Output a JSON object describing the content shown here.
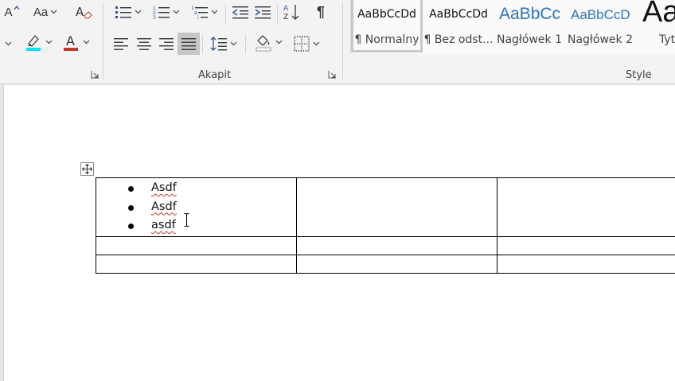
{
  "ribbon": {
    "font_group": {
      "shrink_font_glyph": "A",
      "change_case_glyph": "Aa",
      "font_color_glyph": "A",
      "highlight_color": "#00e5ff",
      "font_color": "#c0392b"
    },
    "paragraph_group": {
      "label": "Akapit",
      "show_marks_glyph": "¶"
    },
    "styles_group": {
      "label": "Style",
      "items": [
        {
          "sample": "AaBbCcDd",
          "name": "¶ Normalny",
          "selected": true
        },
        {
          "sample": "AaBbCcDd",
          "name": "¶ Bez odst...",
          "selected": false
        },
        {
          "sample": "AaBbCc",
          "name": "Nagłówek 1",
          "selected": false
        },
        {
          "sample": "AaBbCcD",
          "name": "Nagłówek 2",
          "selected": false
        },
        {
          "sample": "Aa",
          "name": "Tyt",
          "selected": false
        }
      ]
    }
  },
  "document": {
    "table": {
      "rows": [
        {
          "cells": [
            {
              "bullets": [
                "Asdf",
                "Asdf",
                "asdf"
              ]
            },
            {
              "text": ""
            },
            {
              "text": ""
            }
          ]
        },
        {
          "cells": [
            {
              "text": ""
            },
            {
              "text": ""
            },
            {
              "text": ""
            }
          ]
        },
        {
          "cells": [
            {
              "text": ""
            },
            {
              "text": ""
            },
            {
              "text": ""
            }
          ]
        }
      ]
    }
  },
  "colors": {
    "heading_blue": "#2e74b5",
    "spellcheck": "#c0392b"
  }
}
